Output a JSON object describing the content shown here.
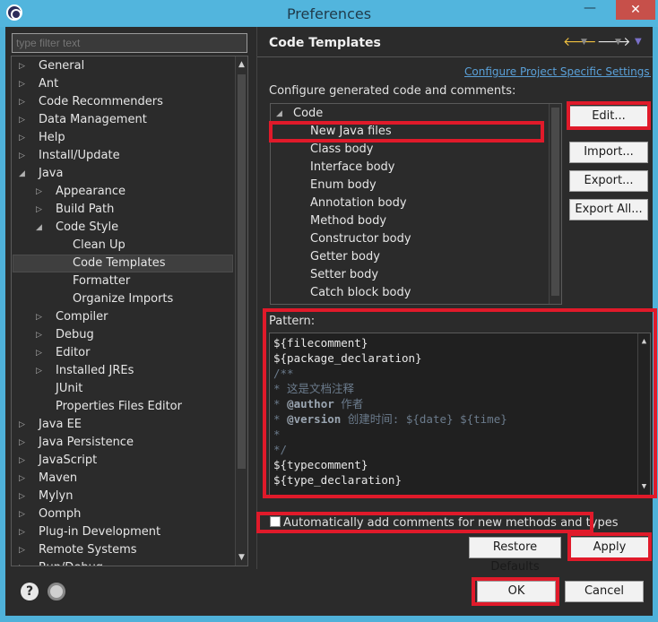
{
  "window": {
    "title": "Preferences",
    "minimize_glyph": "—",
    "close_glyph": "✕"
  },
  "filter": {
    "placeholder": "type filter text"
  },
  "left_tree": [
    {
      "label": "General",
      "level": 0,
      "state": "collapsed"
    },
    {
      "label": "Ant",
      "level": 0,
      "state": "collapsed"
    },
    {
      "label": "Code Recommenders",
      "level": 0,
      "state": "collapsed"
    },
    {
      "label": "Data Management",
      "level": 0,
      "state": "collapsed"
    },
    {
      "label": "Help",
      "level": 0,
      "state": "collapsed"
    },
    {
      "label": "Install/Update",
      "level": 0,
      "state": "collapsed"
    },
    {
      "label": "Java",
      "level": 0,
      "state": "expanded"
    },
    {
      "label": "Appearance",
      "level": 1,
      "state": "collapsed"
    },
    {
      "label": "Build Path",
      "level": 1,
      "state": "collapsed"
    },
    {
      "label": "Code Style",
      "level": 1,
      "state": "expanded"
    },
    {
      "label": "Clean Up",
      "level": 2,
      "state": "leaf"
    },
    {
      "label": "Code Templates",
      "level": 2,
      "state": "leaf",
      "selected": true
    },
    {
      "label": "Formatter",
      "level": 2,
      "state": "leaf"
    },
    {
      "label": "Organize Imports",
      "level": 2,
      "state": "leaf"
    },
    {
      "label": "Compiler",
      "level": 1,
      "state": "collapsed"
    },
    {
      "label": "Debug",
      "level": 1,
      "state": "collapsed"
    },
    {
      "label": "Editor",
      "level": 1,
      "state": "collapsed"
    },
    {
      "label": "Installed JREs",
      "level": 1,
      "state": "collapsed"
    },
    {
      "label": "JUnit",
      "level": 1,
      "state": "leaf"
    },
    {
      "label": "Properties Files Editor",
      "level": 1,
      "state": "leaf"
    },
    {
      "label": "Java EE",
      "level": 0,
      "state": "collapsed"
    },
    {
      "label": "Java Persistence",
      "level": 0,
      "state": "collapsed"
    },
    {
      "label": "JavaScript",
      "level": 0,
      "state": "collapsed"
    },
    {
      "label": "Maven",
      "level": 0,
      "state": "collapsed"
    },
    {
      "label": "Mylyn",
      "level": 0,
      "state": "collapsed"
    },
    {
      "label": "Oomph",
      "level": 0,
      "state": "collapsed"
    },
    {
      "label": "Plug-in Development",
      "level": 0,
      "state": "collapsed"
    },
    {
      "label": "Remote Systems",
      "level": 0,
      "state": "collapsed"
    },
    {
      "label": "Run/Debug",
      "level": 0,
      "state": "collapsed"
    }
  ],
  "page": {
    "title": "Code Templates",
    "link": "Configure Project Specific Settings...",
    "description": "Configure generated code and comments:",
    "pattern_label": "Pattern:",
    "checkbox_label": "Automatically add comments for new methods and types"
  },
  "templates_tree": [
    {
      "label": "Code",
      "level": 0,
      "state": "expanded"
    },
    {
      "label": "New Java files",
      "level": 1
    },
    {
      "label": "Class body",
      "level": 1
    },
    {
      "label": "Interface body",
      "level": 1
    },
    {
      "label": "Enum body",
      "level": 1
    },
    {
      "label": "Annotation body",
      "level": 1
    },
    {
      "label": "Method body",
      "level": 1
    },
    {
      "label": "Constructor body",
      "level": 1
    },
    {
      "label": "Getter body",
      "level": 1
    },
    {
      "label": "Setter body",
      "level": 1
    },
    {
      "label": "Catch block body",
      "level": 1
    }
  ],
  "pattern_lines": [
    {
      "text": "${filecomment}",
      "style": "code"
    },
    {
      "text": "${package_declaration}",
      "style": "code"
    },
    {
      "text": "/**",
      "style": "comment"
    },
    {
      "text": "* 这是文档注释",
      "style": "comment"
    },
    {
      "parts": [
        {
          "text": "* ",
          "style": "comment"
        },
        {
          "text": "@author",
          "style": "annot"
        },
        {
          "text": " 作者",
          "style": "comment"
        }
      ]
    },
    {
      "parts": [
        {
          "text": "* ",
          "style": "comment"
        },
        {
          "text": "@version",
          "style": "annot"
        },
        {
          "text": " 创建时间: ${date} ${time}",
          "style": "comment"
        }
      ]
    },
    {
      "text": "*",
      "style": "comment"
    },
    {
      "text": "*/",
      "style": "comment"
    },
    {
      "text": "${typecomment}",
      "style": "code"
    },
    {
      "text": "${type_declaration}",
      "style": "code"
    }
  ],
  "buttons": {
    "edit": "Edit...",
    "import": "Import...",
    "export": "Export...",
    "export_all": "Export All...",
    "restore_defaults": "Restore Defaults",
    "apply": "Apply",
    "ok": "OK",
    "cancel": "Cancel"
  },
  "icons": {
    "back": "back-arrow-icon",
    "forward": "forward-arrow-icon",
    "menu": "view-menu-icon",
    "help": "help-icon",
    "preferences": "preferences-icon"
  },
  "colors": {
    "highlight": "#e01a2a",
    "titlebar": "#52b5dd",
    "panel": "#2b2b2b"
  }
}
